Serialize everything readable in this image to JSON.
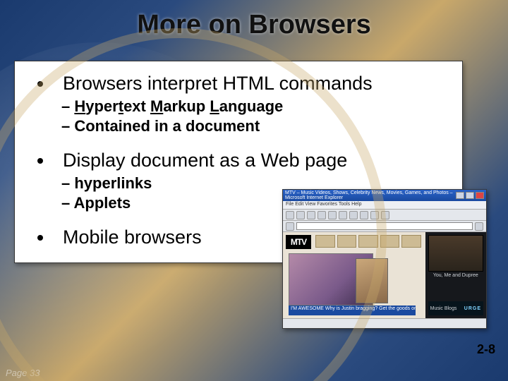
{
  "title": "More on Browsers",
  "bullets": {
    "b1": "Browsers interpret HTML commands",
    "b1_subs": {
      "s1_pre": "H",
      "s1_mid1": "yper",
      "s1_u2": "t",
      "s1_mid2": "ext ",
      "s1_u3": "M",
      "s1_mid3": "arkup ",
      "s1_u4": "L",
      "s1_mid4": "anguage",
      "s2": "Contained in a document"
    },
    "b2": "Display document as a Web page",
    "b2_subs": {
      "s1": "hyperlinks",
      "s2": "Applets"
    },
    "b3": "Mobile browsers"
  },
  "screenshot": {
    "window_title": "MTV – Music Videos, Shows, Celebrity News, Movies, Games, and Photos – Microsoft Internet Explorer",
    "menubar": "File  Edit  View  Favorites  Tools  Help",
    "mtv_logo": "MTV",
    "caption": "I'M AWESOME  Why is Justin bragging? Get the goods on her After Party!",
    "promo_title": "You, Me and Dupree",
    "right_label": "Music Blogs",
    "urge_logo": "URGE"
  },
  "slide_number": "2-8",
  "page_label": "Page 33"
}
